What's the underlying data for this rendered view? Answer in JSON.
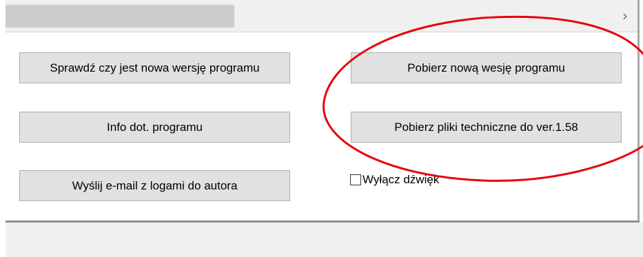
{
  "scrollbar": {
    "arrow_icon": "chevron-right-icon",
    "arrow_glyph": "›"
  },
  "buttons": {
    "check_update": "Sprawdź czy jest nowa  wersję programu",
    "program_info": "Info dot.  programu",
    "send_email": "Wyślij e-mail z logami do autora",
    "download_new": "Pobierz nową wesję programu",
    "download_tech": "Pobierz pliki techniczne do ver.1.58"
  },
  "checkbox": {
    "label": "Wyłącz dźwięk",
    "checked": false
  },
  "annotation": {
    "color": "#e8000b",
    "shape": "ellipse"
  }
}
